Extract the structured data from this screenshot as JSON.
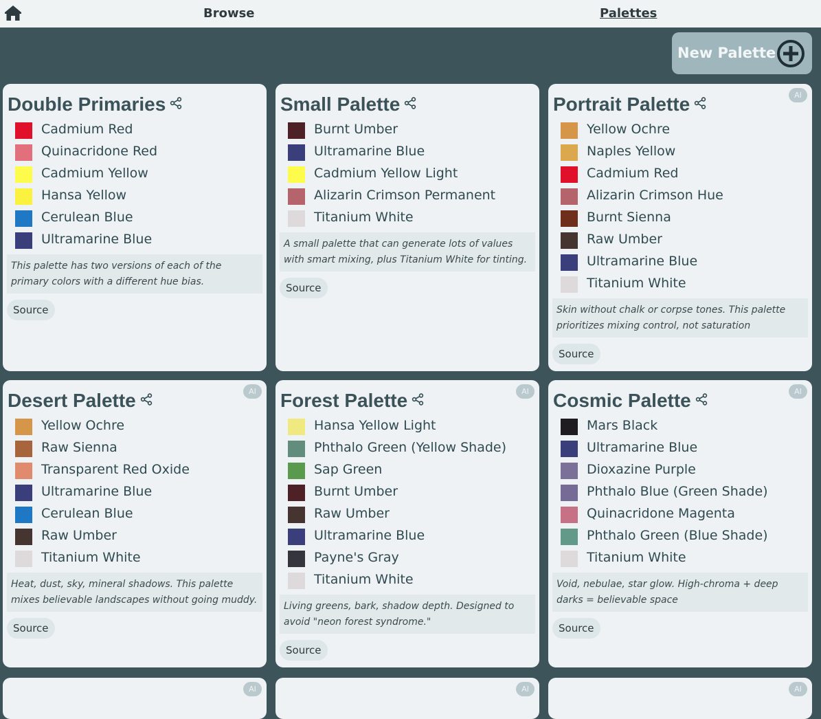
{
  "nav": {
    "home_icon": "home-icon",
    "browse": "Browse",
    "palettes": "Palettes"
  },
  "new_palette": {
    "label": "New Palette",
    "icon": "plus-circle-icon"
  },
  "palettes": [
    {
      "title": "Double Primaries",
      "ai": false,
      "paints": [
        {
          "name": "Cadmium Red",
          "color": "#e0102b"
        },
        {
          "name": "Quinacridone Red",
          "color": "#e2707c"
        },
        {
          "name": "Cadmium Yellow",
          "color": "#fdfc4d"
        },
        {
          "name": "Hansa Yellow",
          "color": "#fbf240"
        },
        {
          "name": "Cerulean Blue",
          "color": "#1f78c3"
        },
        {
          "name": "Ultramarine Blue",
          "color": "#3a3f7b"
        }
      ],
      "description": "This palette has two versions of each of the primary colors with a different hue bias.",
      "source": "Source"
    },
    {
      "title": "Small Palette",
      "ai": false,
      "paints": [
        {
          "name": "Burnt Umber",
          "color": "#4e2127"
        },
        {
          "name": "Ultramarine Blue",
          "color": "#3a3f7b"
        },
        {
          "name": "Cadmium Yellow Light",
          "color": "#fdfc4d"
        },
        {
          "name": "Alizarin Crimson Permanent",
          "color": "#b6646b"
        },
        {
          "name": "Titanium White",
          "color": "#dedadb"
        }
      ],
      "description": "A small palette that can generate lots of values with smart mixing, plus Titanium White for tinting.",
      "source": "Source"
    },
    {
      "title": "Portrait Palette",
      "ai": true,
      "ai_label": "AI",
      "paints": [
        {
          "name": "Yellow Ochre",
          "color": "#d6964a"
        },
        {
          "name": "Naples Yellow",
          "color": "#dba84e"
        },
        {
          "name": "Cadmium Red",
          "color": "#e0102b"
        },
        {
          "name": "Alizarin Crimson Hue",
          "color": "#b6646b"
        },
        {
          "name": "Burnt Sienna",
          "color": "#6f2e1c"
        },
        {
          "name": "Raw Umber",
          "color": "#45342f"
        },
        {
          "name": "Ultramarine Blue",
          "color": "#3a3f7b"
        },
        {
          "name": "Titanium White",
          "color": "#dedadb"
        }
      ],
      "description": "Skin without chalk or corpse tones. This palette prioritizes mixing control, not saturation",
      "source": "Source"
    },
    {
      "title": "Desert Palette",
      "ai": true,
      "ai_label": "AI",
      "paints": [
        {
          "name": "Yellow Ochre",
          "color": "#d6964a"
        },
        {
          "name": "Raw Sienna",
          "color": "#a8643b"
        },
        {
          "name": "Transparent Red Oxide",
          "color": "#e08b6d"
        },
        {
          "name": "Ultramarine Blue",
          "color": "#3a3f7b"
        },
        {
          "name": "Cerulean Blue",
          "color": "#1f78c3"
        },
        {
          "name": "Raw Umber",
          "color": "#45342f"
        },
        {
          "name": "Titanium White",
          "color": "#dedadb"
        }
      ],
      "description": "Heat, dust, sky, mineral shadows. This palette mixes believable landscapes without going muddy.",
      "source": "Source"
    },
    {
      "title": "Forest Palette",
      "ai": true,
      "ai_label": "AI",
      "paints": [
        {
          "name": "Hansa Yellow Light",
          "color": "#f0e97f"
        },
        {
          "name": "Phthalo Green (Yellow Shade)",
          "color": "#628c7b"
        },
        {
          "name": "Sap Green",
          "color": "#5a9a4f"
        },
        {
          "name": "Burnt Umber",
          "color": "#4e2127"
        },
        {
          "name": "Raw Umber",
          "color": "#45342f"
        },
        {
          "name": "Ultramarine Blue",
          "color": "#3a3f7b"
        },
        {
          "name": "Payne's Gray",
          "color": "#35363d"
        },
        {
          "name": "Titanium White",
          "color": "#dedadb"
        }
      ],
      "description": "Living greens, bark, shadow depth. Designed to avoid \"neon forest syndrome.\"",
      "source": "Source"
    },
    {
      "title": "Cosmic Palette",
      "ai": true,
      "ai_label": "AI",
      "paints": [
        {
          "name": "Mars Black",
          "color": "#1e1c20"
        },
        {
          "name": "Ultramarine Blue",
          "color": "#3a3f7b"
        },
        {
          "name": "Dioxazine Purple",
          "color": "#7a7098"
        },
        {
          "name": "Phthalo Blue (Green Shade)",
          "color": "#766a97"
        },
        {
          "name": "Quinacridone Magenta",
          "color": "#c77186"
        },
        {
          "name": "Phthalo Green (Blue Shade)",
          "color": "#629988"
        },
        {
          "name": "Titanium White",
          "color": "#dedadb"
        }
      ],
      "description": "Void, nebulae, star glow. High-chroma + deep darks = believable space",
      "source": "Source"
    },
    {
      "title": "",
      "ai": true,
      "ai_label": "AI",
      "paints": [],
      "description": "",
      "source": ""
    },
    {
      "title": "",
      "ai": true,
      "ai_label": "AI",
      "paints": [],
      "description": "",
      "source": ""
    },
    {
      "title": "",
      "ai": true,
      "ai_label": "AI",
      "paints": [],
      "description": "",
      "source": ""
    }
  ]
}
